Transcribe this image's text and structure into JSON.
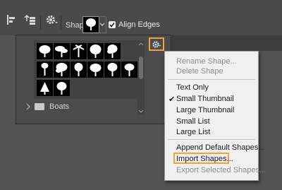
{
  "options_bar": {
    "shape_label": "Shape:",
    "align_edges_label": "Align Edges",
    "align_edges_checked": true
  },
  "picker": {
    "folder_label": "Boats",
    "thumbnails": [
      "tree-1",
      "tree-2",
      "tree-3",
      "tree-4",
      "tree-5",
      "tree-6",
      "tree-7",
      "tree-8",
      "tree-9",
      "tree-10",
      "tree-11",
      "tree-12",
      "tree-13",
      "tree-14"
    ]
  },
  "menu": {
    "items": [
      {
        "label": "Rename Shape...",
        "enabled": false
      },
      {
        "label": "Delete Shape",
        "enabled": false
      },
      {
        "label": "Text Only",
        "enabled": true
      },
      {
        "label": "Small Thumbnail",
        "enabled": true,
        "checked": true
      },
      {
        "label": "Large Thumbnail",
        "enabled": true
      },
      {
        "label": "Small List",
        "enabled": true
      },
      {
        "label": "Large List",
        "enabled": true
      },
      {
        "label": "Append Default Shapes...",
        "enabled": true
      },
      {
        "label": "Import Shapes...",
        "enabled": true,
        "highlighted": true
      },
      {
        "label": "Export Selected Shapes...",
        "enabled": false
      }
    ]
  },
  "colors": {
    "highlight": "#f0a23a",
    "menu_bg": "#f0f0f0",
    "panel_bg": "#4b4b4b"
  }
}
